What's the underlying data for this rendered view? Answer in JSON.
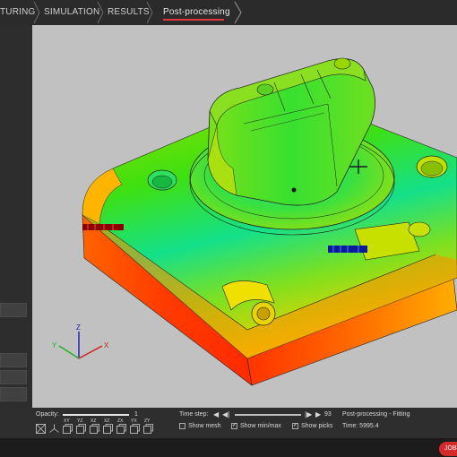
{
  "nav": {
    "items": [
      {
        "label": "TURING"
      },
      {
        "label": "SIMULATION"
      },
      {
        "label": "RESULTS"
      },
      {
        "label": "Post-processing"
      }
    ]
  },
  "viewport": {
    "axes": {
      "z": "Z",
      "y": "Y",
      "x": "X"
    }
  },
  "toolbar": {
    "opacity_label": "Opacity:",
    "opacity_value": "1",
    "opacity_fraction": 1.0,
    "timestep_label": "Time step:",
    "timestep_value": "93",
    "show_mesh": "Show mesh",
    "show_minmax": "Show min/max",
    "show_picks": "Show picks",
    "status_title": "Post-processing - Fitting",
    "status_time": "Time: 5995.4",
    "view_icons": [
      "xyz-view-icon",
      "iso-view-icon",
      "xy-view-icon",
      "yz-view-icon",
      "xz-view-icon",
      "xz-neg-view-icon",
      "zx-view-icon",
      "yx-view-icon",
      "zy-view-icon"
    ],
    "view_labels": [
      "",
      "",
      "XY",
      "YZ",
      "XZ",
      "XZ",
      "ZX",
      "YX",
      "ZY"
    ]
  },
  "statusbar": {
    "job_label": "JOB"
  },
  "colors": {
    "accent_red": "#e0393e",
    "job_red": "#d42a2a",
    "viewport_bg": "#c1c1c1"
  }
}
